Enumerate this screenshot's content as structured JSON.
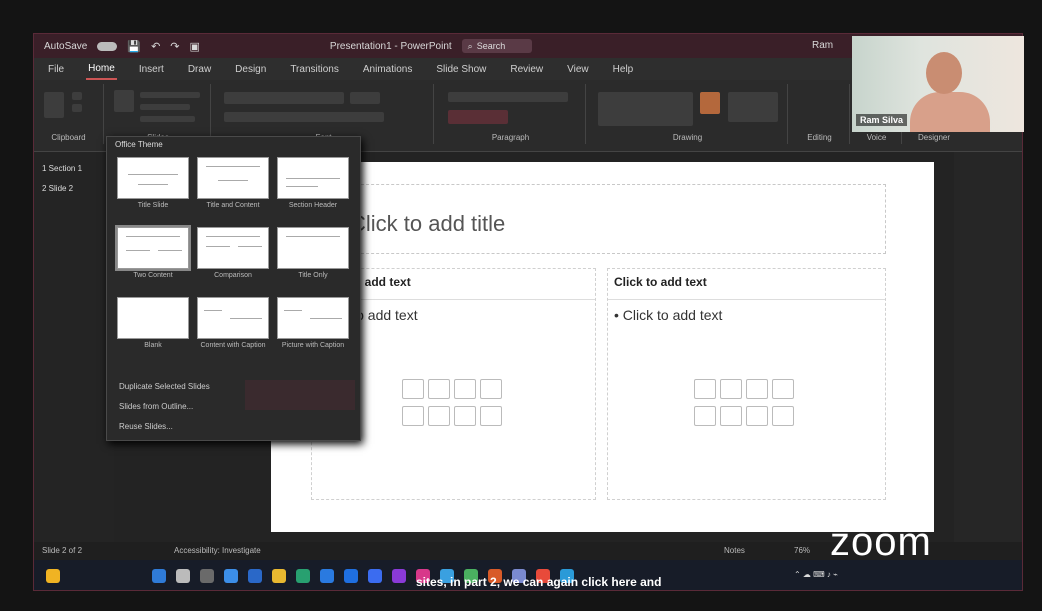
{
  "window": {
    "autosave_label": "AutoSave",
    "doc_title": "Presentation1 - PowerPoint",
    "search_label": "Search",
    "user_name": "Ram"
  },
  "ribbon_tabs": [
    "File",
    "Home",
    "Insert",
    "Draw",
    "Design",
    "Transitions",
    "Animations",
    "Slide Show",
    "Review",
    "View",
    "Help"
  ],
  "ribbon_groups": [
    "Clipboard",
    "Slides",
    "Font",
    "Paragraph",
    "Drawing",
    "Editing",
    "Voice",
    "Designer"
  ],
  "thumbnails": {
    "items": [
      "1 Section 1",
      "2 Slide 2"
    ]
  },
  "slide": {
    "title_placeholder": "Click to add title",
    "left_col_header": "Click to add text",
    "left_col_bullet": "Click to add text",
    "right_col_header": "Click to add text",
    "right_col_bullet": "• Click to add text"
  },
  "layout_menu": {
    "header": "Office Theme",
    "layouts": [
      "Title Slide",
      "Title and Content",
      "Section Header",
      "Two Content",
      "Comparison",
      "Title Only",
      "Blank",
      "Content with Caption",
      "Picture with Caption"
    ],
    "options": [
      "Duplicate Selected Slides",
      "Slides from Outline...",
      "Reuse Slides..."
    ]
  },
  "statusbar": {
    "slide_info": "Slide 2 of 2",
    "accessibility": "Accessibility: Investigate",
    "notes": "Notes",
    "zoom_pct": "76%"
  },
  "caption": "sites, in part 2, we can again click here and",
  "watermark": "zoom",
  "webcam": {
    "name_label": "Ram Silva"
  },
  "colors": {
    "titlebar": "#3a1f28",
    "accent": "#c55555",
    "taskbar": "#171c28"
  }
}
